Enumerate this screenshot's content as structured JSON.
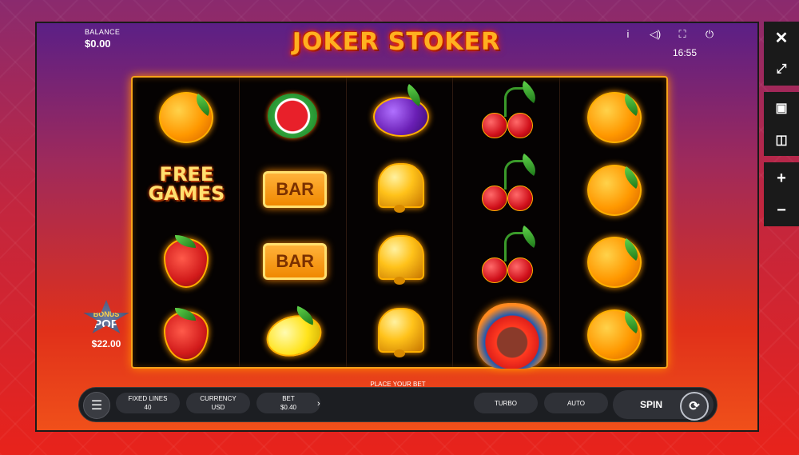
{
  "balance": {
    "label": "BALANCE",
    "value": "$0.00"
  },
  "logo": "JOKER STOKER",
  "top_icons": [
    "info-icon",
    "sound-icon",
    "fullscreen-icon",
    "power-icon"
  ],
  "clock": "16:55",
  "free_games": {
    "line1": "FREE",
    "line2": "GAMES"
  },
  "bar_label": "BAR",
  "bonus_pop": {
    "line1": "BONUS",
    "line2": "POP",
    "value": "$22.00"
  },
  "controls": {
    "place_bet": "PLACE YOUR BET",
    "fixed_lines": {
      "label": "FIXED LINES",
      "value": "40"
    },
    "currency": {
      "label": "CURRENCY",
      "value": "USD"
    },
    "bet": {
      "label": "BET",
      "value": "$0.40",
      "arrow": "›"
    },
    "turbo": "TURBO",
    "auto": "AUTO",
    "spin": "SPIN"
  },
  "reels": [
    [
      "orange",
      "free-games",
      "strawberry",
      "strawberry"
    ],
    [
      "watermelon",
      "bar",
      "bar",
      "lemon"
    ],
    [
      "plum",
      "bell",
      "bell",
      "bell"
    ],
    [
      "cherry",
      "cherry",
      "cherry",
      "joker"
    ],
    [
      "orange",
      "orange",
      "orange",
      "orange"
    ]
  ]
}
